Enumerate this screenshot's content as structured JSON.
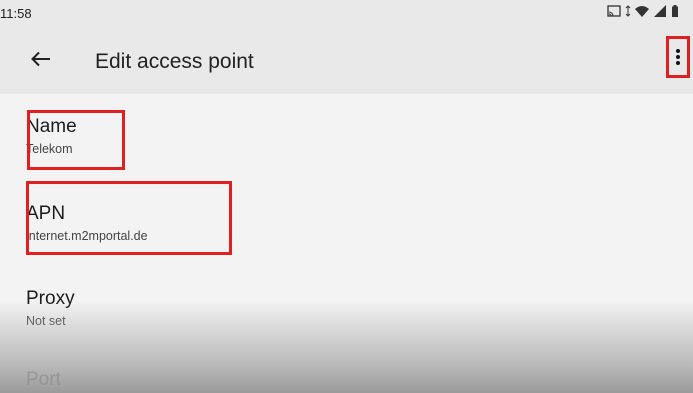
{
  "status_bar": {
    "time": "11:58",
    "icons": [
      "cast-icon",
      "data-transfer-icon",
      "wifi-icon",
      "signal-icon",
      "battery-icon"
    ]
  },
  "app_bar": {
    "back_icon": "arrow-back-icon",
    "title": "Edit access point",
    "more_icon": "more-vert-icon"
  },
  "preferences": [
    {
      "title": "Name",
      "summary": "Telekom"
    },
    {
      "title": "APN",
      "summary": "internet.m2mportal.de"
    },
    {
      "title": "Proxy",
      "summary": "Not set"
    },
    {
      "title": "Port",
      "summary": ""
    }
  ],
  "colors": {
    "highlight": "#e02020",
    "background": "#f3f3f3",
    "app_bar": "#e9e9e9"
  }
}
